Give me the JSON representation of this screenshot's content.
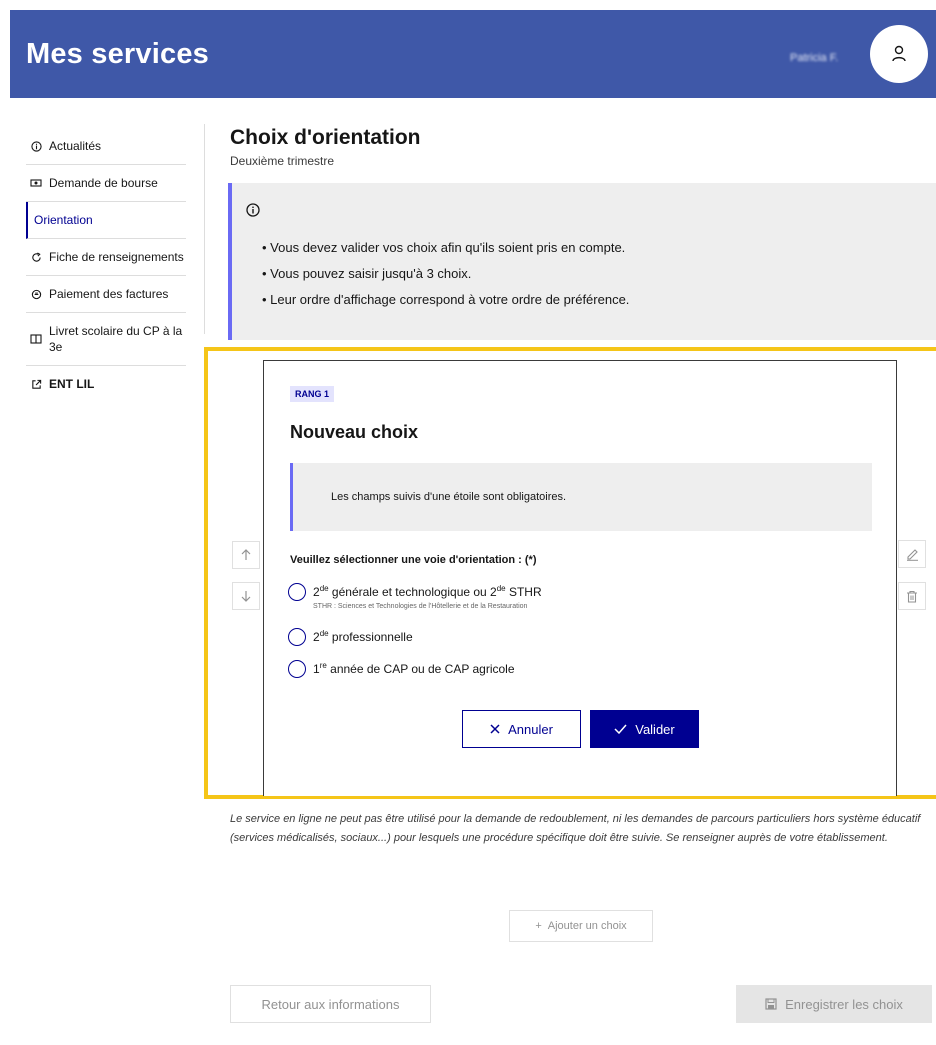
{
  "header": {
    "title": "Mes services",
    "user_name": "Patricia F.",
    "avatar_icon": "user-icon",
    "background": "#3f58a8"
  },
  "sidebar": {
    "items": [
      {
        "label": "Actualités",
        "icon": "info-circle-icon"
      },
      {
        "label": "Demande de bourse",
        "icon": "money-icon"
      },
      {
        "label": "Orientation",
        "icon": "",
        "active": true
      },
      {
        "label": "Fiche de renseignements",
        "icon": "refresh-icon"
      },
      {
        "label": "Paiement des factures",
        "icon": "coins-icon"
      },
      {
        "label": "Livret scolaire du CP à la 3e",
        "icon": "book-icon"
      },
      {
        "label": "ENT LIL",
        "icon": "external-link-icon"
      }
    ]
  },
  "main": {
    "title": "Choix d'orientation",
    "subtitle": "Deuxième trimestre",
    "info": {
      "icon": "info-circle-icon",
      "items": [
        "Vous devez valider vos choix afin qu'ils soient pris en compte.",
        "Vous pouvez saisir jusqu'à 3 choix.",
        "Leur ordre d'affichage correspond à votre ordre de préférence."
      ]
    },
    "choice_card": {
      "rank_badge": "RANG 1",
      "title": "Nouveau choix",
      "notice": "Les champs suivis d'une étoile sont obligatoires.",
      "legend": "Veuillez sélectionner une voie d'orientation : (*)",
      "options": [
        {
          "pre": "2",
          "sup": "de",
          "text": " générale et technologique ou 2",
          "sup2": "de",
          "text2": " STHR",
          "hint": "STHR : Sciences et Technologies de l'Hôtellerie et de la Restauration"
        },
        {
          "pre": "2",
          "sup": "de",
          "text": " professionnelle"
        },
        {
          "pre": "1",
          "sup": "re",
          "text": " année de CAP ou de CAP agricole"
        }
      ],
      "cancel_label": "Annuler",
      "validate_label": "Valider"
    },
    "disclaimer": "Le service en ligne ne peut pas être utilisé pour la demande de redoublement, ni les demandes de parcours particuliers hors système éducatif (services médicalisés, sociaux...) pour lesquels une procédure spécifique doit être suivie. Se renseigner auprès de votre établissement.",
    "add_choice_label": "Ajouter un choix",
    "back_label": "Retour aux informations",
    "save_label": "Enregistrer les choix"
  },
  "colors": {
    "primary": "#000091",
    "accent": "#6a6af4",
    "highlight": "#f5c518"
  }
}
